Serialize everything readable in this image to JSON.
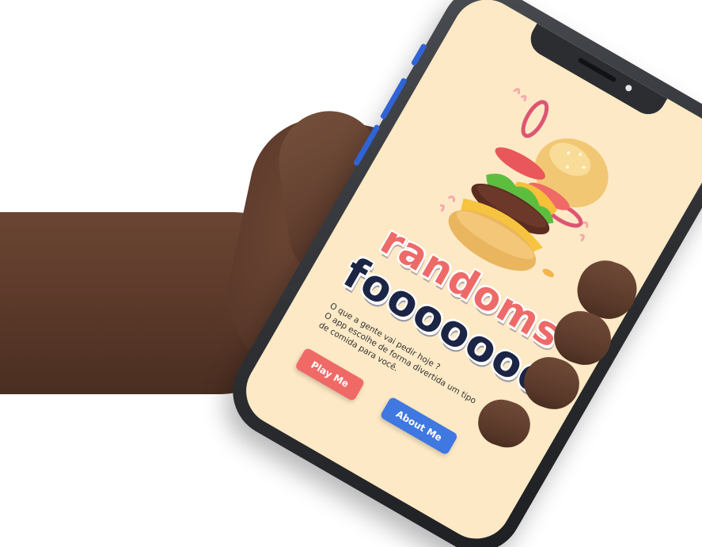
{
  "app": {
    "title_line1": "randoms",
    "title_line2": "fooooood",
    "description_lines": [
      "O que a gente vai pedir hoje ?",
      "O app escolhe de forma divertida um tipo",
      "de comida para você."
    ]
  },
  "buttons": {
    "play_label": "Play Me",
    "about_label": "About Me"
  },
  "colors": {
    "screen_background": "#fde9c5",
    "title_primary": "#ee6a68",
    "title_secondary": "#1d2545",
    "play_button": "#ef6a66",
    "about_button": "#3f78e0",
    "phone_frame": "#2c2e32"
  },
  "illustration": {
    "icon": "burger-illustration"
  }
}
